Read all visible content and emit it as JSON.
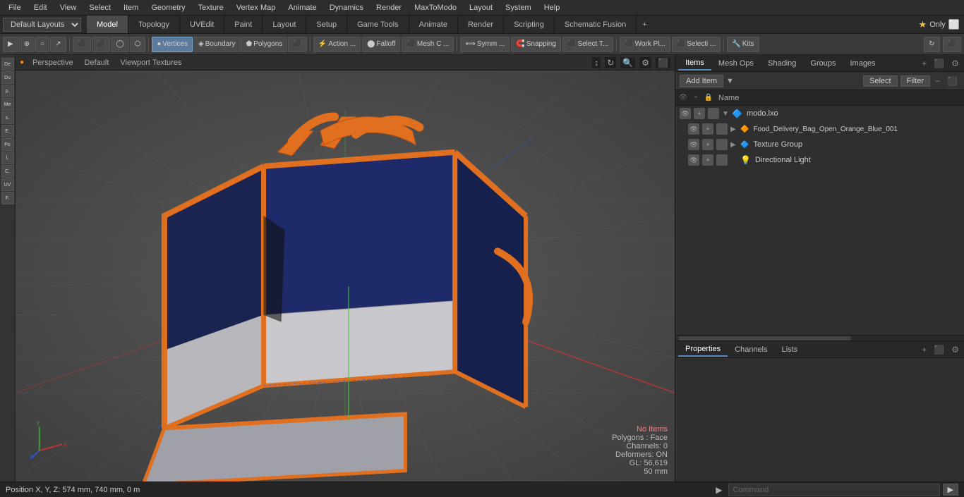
{
  "menu": {
    "items": [
      "File",
      "Edit",
      "View",
      "Select",
      "Item",
      "Geometry",
      "Texture",
      "Vertex Map",
      "Animate",
      "Dynamics",
      "Render",
      "MaxToModo",
      "Layout",
      "System",
      "Help"
    ]
  },
  "layout_bar": {
    "dropdown": "Default Layouts",
    "tabs": [
      "Model",
      "Topology",
      "UVEdit",
      "Paint",
      "Layout",
      "Setup",
      "Game Tools",
      "Animate",
      "Render",
      "Scripting",
      "Schematic Fusion"
    ],
    "active_tab": "Model",
    "add_icon": "+",
    "star_label": "Only"
  },
  "toolbar": {
    "left_tools": [
      "▶",
      "⊕",
      "○",
      "↗",
      "⬜",
      "⬜",
      "◯",
      "⬡"
    ],
    "component_modes": [
      "Vertices",
      "Boundary",
      "Polygons",
      "⬜"
    ],
    "action_label": "Action ...",
    "falloff_label": "Falloff",
    "mesh_label": "Mesh C ...",
    "symm_label": "Symm ...",
    "snapping_label": "Snapping",
    "select_t_label": "Select T...",
    "workpl_label": "Work Pl...",
    "selecti_label": "Selecti ...",
    "kits_label": "Kits",
    "icons_right": [
      "↻",
      "⬛"
    ]
  },
  "viewport": {
    "header": {
      "dot_label": "●",
      "perspective_label": "Perspective",
      "default_label": "Default",
      "textures_label": "Viewport Textures"
    },
    "top_right_icons": [
      "↕",
      "↻",
      "🔍",
      "⚙",
      "⬛"
    ],
    "status": {
      "no_items": "No Items",
      "polygons": "Polygons : Face",
      "channels": "Channels: 0",
      "deformers": "Deformers: ON",
      "gl": "GL: 56,619",
      "units": "50 mm"
    }
  },
  "status_bar": {
    "position_label": "Position X, Y, Z:",
    "position_value": "574 mm, 740 mm, 0 m",
    "command_placeholder": "Command",
    "command_arrow": "▶"
  },
  "right_panel": {
    "tabs": [
      "Items",
      "Mesh Ops",
      "Shading",
      "Groups",
      "Images"
    ],
    "active_tab": "Items",
    "add_item_label": "Add Item",
    "column_header": "Name",
    "select_btn": "Select",
    "filter_btn": "Filter",
    "items": [
      {
        "id": 0,
        "indent": 0,
        "expand": "▼",
        "icon": "🔷",
        "name": "modo.lxo",
        "level": 0
      },
      {
        "id": 1,
        "indent": 1,
        "expand": "▶",
        "icon": "🔷",
        "name": "Food_Delivery_Bag_Open_Orange_Blue_001",
        "level": 1
      },
      {
        "id": 2,
        "indent": 1,
        "expand": "▶",
        "icon": "🔷",
        "name": "Texture Group",
        "level": 1
      },
      {
        "id": 3,
        "indent": 1,
        "expand": "",
        "icon": "💡",
        "name": "Directional Light",
        "level": 1
      }
    ],
    "properties_tabs": [
      "Properties",
      "Channels",
      "Lists"
    ],
    "active_props_tab": "Properties"
  },
  "axes": {
    "x_label": "X",
    "y_label": "Y",
    "z_label": "Z"
  }
}
